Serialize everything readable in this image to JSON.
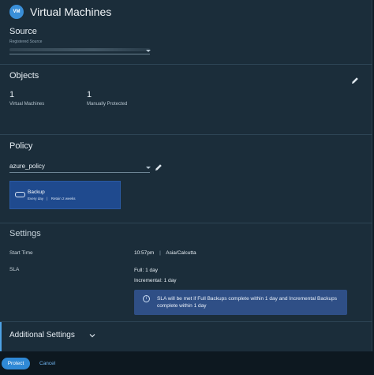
{
  "header": {
    "logo_text": "VM",
    "title": "Virtual Machines"
  },
  "source": {
    "heading": "Source",
    "field_label": "Registered Source"
  },
  "objects": {
    "heading": "Objects",
    "stats": [
      {
        "value": "1",
        "label": "Virtual Machines"
      },
      {
        "value": "1",
        "label": "Manually Protected"
      }
    ]
  },
  "policy": {
    "heading": "Policy",
    "selected": "azure_policy",
    "card": {
      "name": "Backup",
      "frequency": "Every day",
      "separator": "|",
      "retention": "Retain 2 weeks"
    }
  },
  "settings": {
    "heading": "Settings",
    "start_time_label": "Start Time",
    "start_time_value": "10:57pm",
    "timezone": "Asia/Calcutta",
    "sla_label": "SLA",
    "sla_full": "Full: 1 day",
    "sla_incremental": "Incremental: 1 day",
    "info_icon": "i",
    "info_text": "SLA will be met if Full Backups complete within 1 day and Incremental Backups complete within 1 day"
  },
  "additional_settings": {
    "label": "Additional Settings"
  },
  "footer": {
    "protect_label": "Protect",
    "cancel_label": "Cancel"
  },
  "colors": {
    "accent": "#2f89d6",
    "panel": "#1b2d3a",
    "policy_card": "#1f4a8e",
    "info_box": "#2f4f86"
  }
}
